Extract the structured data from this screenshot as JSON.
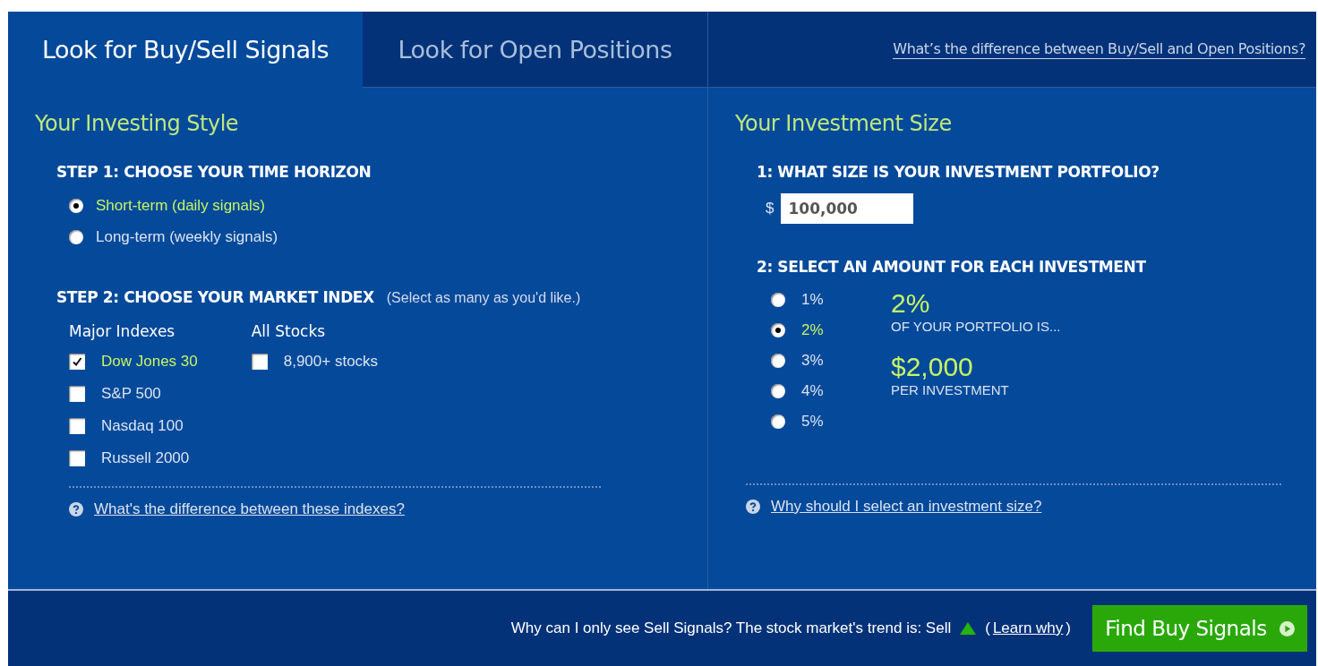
{
  "tabs": [
    {
      "label": "Look for Buy/Sell Signals",
      "selected": true
    },
    {
      "label": "Look for Open Positions",
      "selected": false
    }
  ],
  "header_link": "What’s the difference between Buy/Sell and Open Positions?",
  "investing_style": {
    "title": "Your Investing Style",
    "step1": {
      "heading": "STEP 1: CHOOSE YOUR TIME HORIZON",
      "options": [
        {
          "label": "Short-term (daily signals)",
          "selected": true
        },
        {
          "label": "Long-term (weekly signals)",
          "selected": false
        }
      ]
    },
    "step2": {
      "heading": "STEP 2: CHOOSE YOUR MARKET INDEX",
      "hint": "(Select as many as you'd like.)",
      "groups": [
        {
          "title": "Major Indexes",
          "items": [
            {
              "label": "Dow Jones 30",
              "checked": true
            },
            {
              "label": "S&P 500",
              "checked": false
            },
            {
              "label": "Nasdaq 100",
              "checked": false
            },
            {
              "label": "Russell 2000",
              "checked": false
            }
          ]
        },
        {
          "title": "All Stocks",
          "items": [
            {
              "label": "8,900+ stocks",
              "checked": false
            }
          ]
        }
      ]
    },
    "help_link": "What's the difference between these indexes?"
  },
  "investment_size": {
    "title": "Your Investment Size",
    "step1": {
      "heading": "1: WHAT SIZE IS YOUR INVESTMENT PORTFOLIO?",
      "currency": "$",
      "value": "100,000"
    },
    "step2": {
      "heading": "2: SELECT AN AMOUNT FOR EACH INVESTMENT",
      "options": [
        {
          "label": "1%",
          "selected": false
        },
        {
          "label": "2%",
          "selected": true
        },
        {
          "label": "3%",
          "selected": false
        },
        {
          "label": "4%",
          "selected": false
        },
        {
          "label": "5%",
          "selected": false
        }
      ]
    },
    "summary": {
      "percent": "2%",
      "percent_caption": "OF YOUR PORTFOLIO IS...",
      "amount": "$2,000",
      "amount_caption": "PER INVESTMENT"
    },
    "help_link": "Why should I select an investment size?"
  },
  "footer": {
    "note": "Why can I only see Sell Signals? The stock market's trend is: Sell",
    "paren_open": "(",
    "link": "Learn why",
    "paren_close": ")",
    "button": "Find Buy Signals"
  }
}
